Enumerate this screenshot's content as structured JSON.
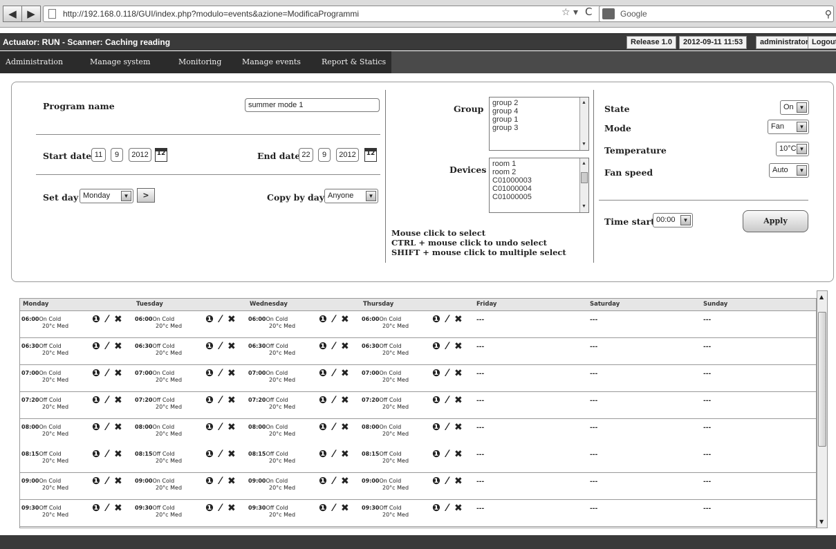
{
  "browser": {
    "back_glyph": "◀",
    "forward_glyph": "▶",
    "url": "http://192.168.0.118/GUI/index.php?modulo=events&azione=ModificaProgrammi",
    "search_placeholder": "Google",
    "star_glyph": "☆ ▾",
    "refresh_glyph": "C",
    "search_glyph": "⚲"
  },
  "status": {
    "text": "Actuator: RUN - Scanner: Caching reading",
    "release": "Release 1.0",
    "datetime": "2012-09-11 11:53",
    "user": "administrator",
    "logout": "Logout"
  },
  "menu": [
    "Administration",
    "Manage system",
    "Monitoring",
    "Manage events",
    "Report & Statics"
  ],
  "form": {
    "program_name_label": "Program name",
    "program_name_value": "summer mode 1",
    "start_date_label": "Start date",
    "start_day": "11",
    "start_month": "9",
    "start_year": "2012",
    "end_date_label": "End date",
    "end_day": "22",
    "end_month": "9",
    "end_year": "2012",
    "calendar_glyph": "12",
    "set_day_label": "Set day",
    "set_day_value": "Monday",
    "next_button": ">",
    "copy_by_day_label": "Copy by day",
    "copy_by_day_value": "Anyone",
    "group_label": "Group",
    "groups": [
      "group 2",
      "group 4",
      "group 1",
      "group 3"
    ],
    "devices_label": "Devices",
    "devices": [
      "room 1",
      "room 2",
      "C01000003",
      "C01000004",
      "C01000005"
    ],
    "help_lines": [
      "Mouse click to select",
      "CTRL + mouse click to undo select",
      "SHIFT + mouse click to multiple select"
    ],
    "state_label": "State",
    "state_value": "On",
    "mode_label": "Mode",
    "mode_value": "Fan",
    "temperature_label": "Temperature",
    "temperature_value": "10°C",
    "fan_speed_label": "Fan speed",
    "fan_speed_value": "Auto",
    "time_start_label": "Time start",
    "time_start_value": "00:00",
    "apply_button": "Apply",
    "dropdown_glyph": "▼"
  },
  "schedule": {
    "days": [
      "Monday",
      "Tuesday",
      "Wednesday",
      "Thursday",
      "Friday",
      "Saturday",
      "Sunday"
    ],
    "icons_glyph": "❶ ⁄ ✖",
    "empty": "---",
    "rows": [
      {
        "time": "06:00",
        "state": "On Cold",
        "detail": "20°c Med"
      },
      {
        "time": "06:30",
        "state": "Off Cold",
        "detail": "20°c Med"
      },
      {
        "time": "07:00",
        "state": "On Cold",
        "detail": "20°c Med"
      },
      {
        "time": "07:20",
        "state": "Off Cold",
        "detail": "20°c Med"
      },
      {
        "time": "08:00",
        "state": "On Cold",
        "detail": "20°c Med"
      },
      {
        "time": "08:15",
        "state": "Off Cold",
        "detail": "20°c Med"
      },
      {
        "time": "09:00",
        "state": "On Cold",
        "detail": "20°c Med"
      },
      {
        "time": "09:30",
        "state": "Off Cold",
        "detail": "20°c Med"
      }
    ]
  }
}
